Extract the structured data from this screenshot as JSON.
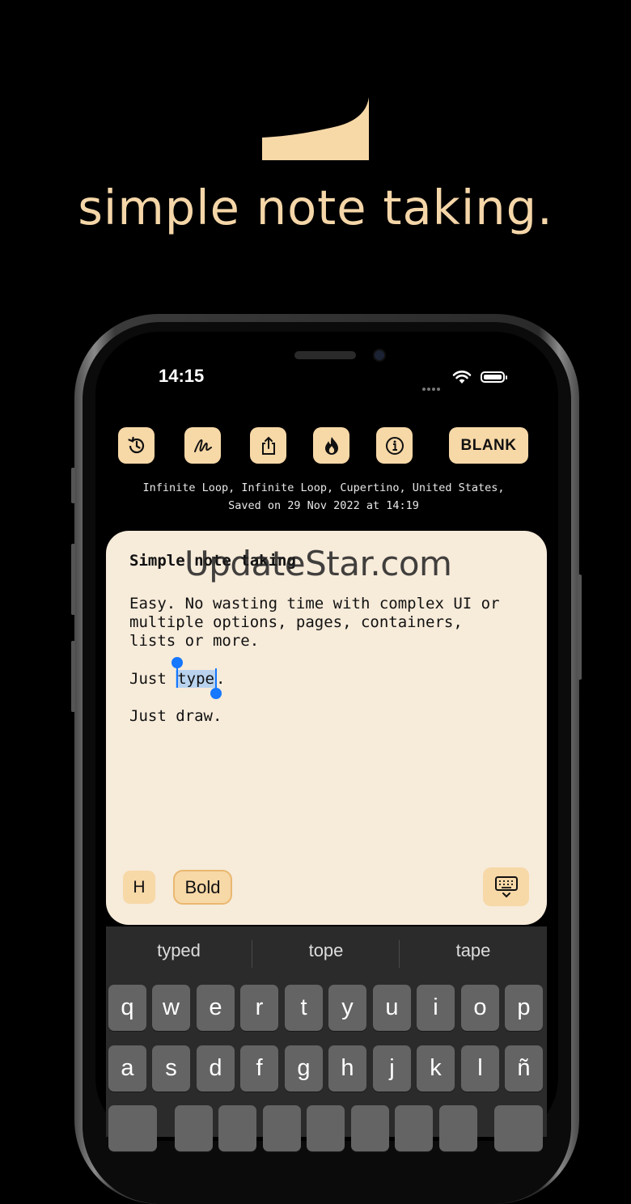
{
  "colors": {
    "accent": "#f7d8a7",
    "background": "#000000",
    "note_bg": "#f7ebda",
    "selection_handle": "#1677ff"
  },
  "tagline": "simple note taking.",
  "status_bar": {
    "time": "14:15"
  },
  "toolbar": {
    "icons": [
      "history-icon",
      "draw-icon",
      "share-icon",
      "flame-icon",
      "info-icon"
    ],
    "blank_label": "BLANK"
  },
  "location": {
    "line1": "Infinite Loop, Infinite Loop, Cupertino, United States,",
    "line2": "Saved on 29 Nov 2022 at 14:19"
  },
  "note": {
    "title": "Simple note taking",
    "para1": [
      "Easy. No wasting time with complex UI or",
      "multiple options, pages, containers,",
      "lists or more."
    ],
    "para2_prefix": "Just ",
    "para2_selected": "type",
    "para2_suffix": ".",
    "para3": "Just draw."
  },
  "watermark": "UpdateStar.com",
  "format_bar": {
    "heading_label": "H",
    "bold_label": "Bold"
  },
  "keyboard": {
    "suggestions": [
      "typed",
      "tope",
      "tape"
    ],
    "row1": [
      "q",
      "w",
      "e",
      "r",
      "t",
      "y",
      "u",
      "i",
      "o",
      "p"
    ],
    "row2": [
      "a",
      "s",
      "d",
      "f",
      "g",
      "h",
      "j",
      "k",
      "l",
      "ñ"
    ]
  }
}
